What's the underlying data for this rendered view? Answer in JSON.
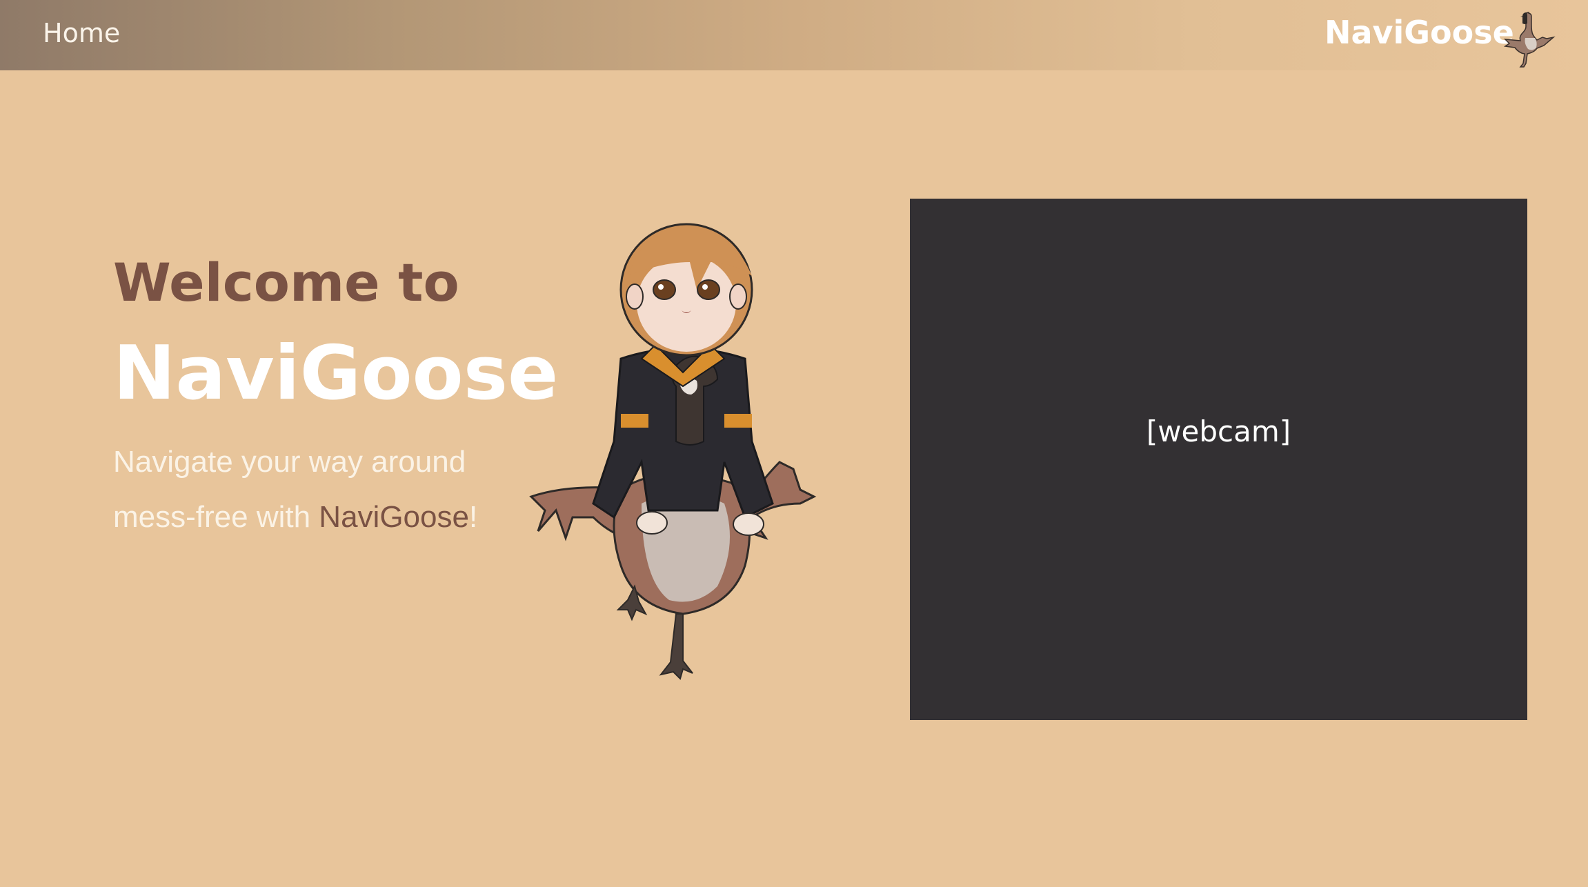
{
  "nav": {
    "home_label": "Home",
    "brand": "NaviGoose",
    "logo_icon": "goose-icon"
  },
  "hero": {
    "welcome": "Welcome to",
    "brand": "NaviGoose",
    "tagline_line1": "Navigate your way around",
    "tagline_line2_prefix": "mess-free with ",
    "tagline_brand": "NaviGoose",
    "tagline_suffix": "!",
    "mascot_icon": "girl-riding-goose-illustration"
  },
  "webcam": {
    "label": "[webcam]"
  },
  "colors": {
    "background": "#e8c59b",
    "accent_brown": "#7a5244",
    "webcam_bg": "#333033",
    "white": "#ffffff"
  }
}
